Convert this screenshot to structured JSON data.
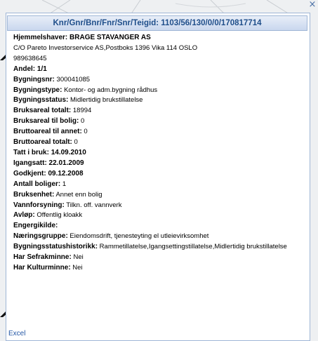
{
  "popup": {
    "title": "Knr/Gnr/Bnr/Fnr/Snr/Teigid: 1103/56/130/0/0/170817714",
    "close_icon": "close-icon"
  },
  "owner": {
    "label": "Hjemmelshaver: BRAGE STAVANGER AS",
    "address": "C/O Pareto Investorservice AS,Postboks 1396 Vika 114 OSLO",
    "number": "989638645",
    "share_label": "Andel: 1/1"
  },
  "fields": {
    "bygningsnr": {
      "label": "Bygningsnr:",
      "value": " 300041085"
    },
    "bygningstype": {
      "label": "Bygningstype:",
      "value": " Kontor- og adm.bygning rådhus"
    },
    "bygningsstatus": {
      "label": "Bygningsstatus:",
      "value": " Midlertidig brukstillatelse"
    },
    "bruksareal_totalt": {
      "label": "Bruksareal totalt:",
      "value": " 18994"
    },
    "bruksareal_bolig": {
      "label": "Bruksareal til bolig:",
      "value": " 0"
    },
    "bruttoareal_annet": {
      "label": "Bruttoareal til annet:",
      "value": " 0"
    },
    "bruttoareal_totalt": {
      "label": "Bruttoareal totalt:",
      "value": " 0"
    },
    "tatt_i_bruk": {
      "label": "Tatt i bruk:",
      "value": " 14.09.2010"
    },
    "igangsatt": {
      "label": "Igangsatt:",
      "value": " 22.01.2009"
    },
    "godkjent": {
      "label": "Godkjent:",
      "value": " 09.12.2008"
    },
    "antall_boliger": {
      "label": "Antall boliger:",
      "value": " 1"
    },
    "bruksenhet": {
      "label": "Bruksenhet:",
      "value": " Annet enn bolig"
    },
    "vannforsyning": {
      "label": "Vannforsyning:",
      "value": " Tilkn. off. vannverk"
    },
    "avlop": {
      "label": "Avløp:",
      "value": " Offentlig kloakk"
    },
    "energikilde": {
      "label": "Engergikilde:",
      "value": ""
    },
    "naeringsgruppe": {
      "label": "Næringsgruppe:",
      "value": " Eiendomsdrift, tjenesteyting el utleievirksomhet"
    },
    "statushistorikk": {
      "label": "Bygningsstatushistorikk:",
      "value": " Rammetillatelse,Igangsettingstillatelse,Midlertidig brukstillatelse"
    },
    "sefrakminne": {
      "label": "Har Sefrakminne:",
      "value": " Nei"
    },
    "kulturminne": {
      "label": "Har Kulturminne:",
      "value": " Nei"
    }
  },
  "links": {
    "excel": "Excel"
  }
}
